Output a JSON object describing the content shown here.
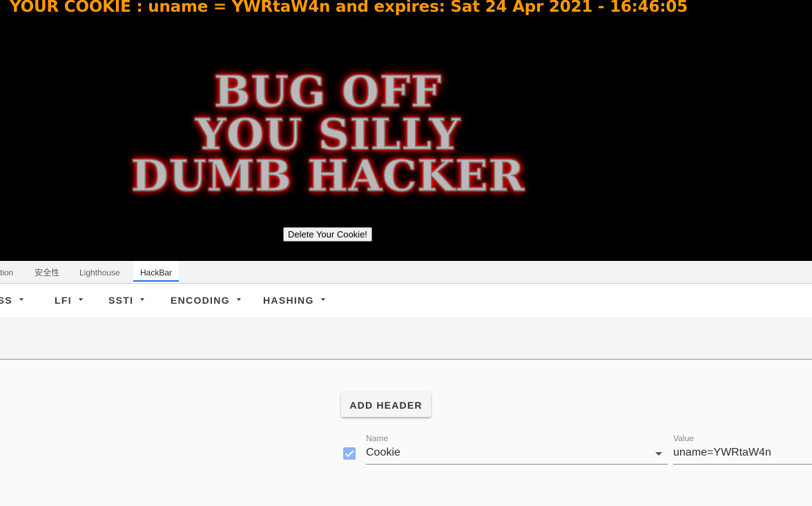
{
  "webpage": {
    "cookie_line": "YOUR COOKIE : uname = YWRtaW4n and expires: Sat 24 Apr 2021 - 16:46:05",
    "banner_lines": [
      "BUG OFF",
      "YOU SILLY",
      "DUMB HACKER"
    ],
    "delete_button_label": "Delete Your Cookie!"
  },
  "devtools": {
    "tabs": [
      {
        "label": "tion",
        "active": false
      },
      {
        "label": "安全性",
        "active": false
      },
      {
        "label": "Lighthouse",
        "active": false
      },
      {
        "label": "HackBar",
        "active": true
      }
    ]
  },
  "hackbar": {
    "menu": [
      {
        "label": "XSS",
        "icon": "caret-down-icon"
      },
      {
        "label": "LFI",
        "icon": "caret-down-icon"
      },
      {
        "label": "SSTI",
        "icon": "caret-down-icon"
      },
      {
        "label": "ENCODING",
        "icon": "caret-down-icon"
      },
      {
        "label": "HASHING",
        "icon": "caret-down-icon"
      }
    ],
    "url_value": "",
    "add_header_label": "ADD HEADER",
    "header_row": {
      "enabled": true,
      "name_label": "Name",
      "name_value": "Cookie",
      "value_label": "Value",
      "value_value": "uname=YWRtaW4n"
    }
  },
  "colors": {
    "cookie_text": "#ff9900",
    "banner_glow": "#ff0000",
    "active_tab_underline": "#1a73e8",
    "checkbox": "#8ab4f8"
  }
}
